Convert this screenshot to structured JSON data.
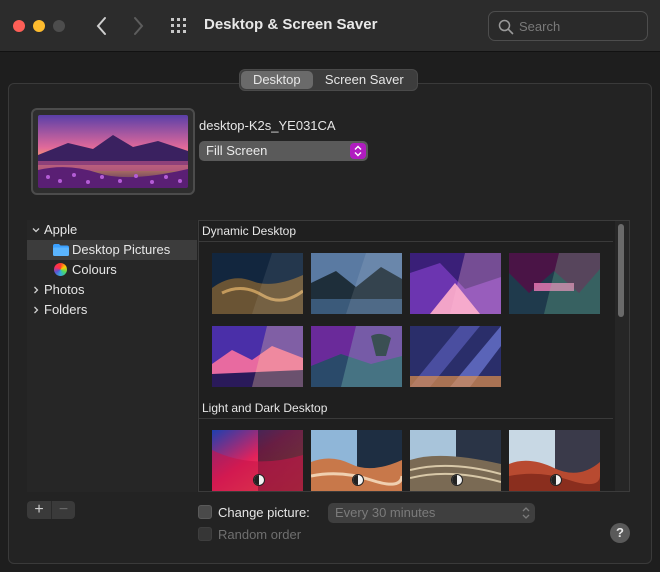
{
  "window": {
    "title": "Desktop & Screen Saver"
  },
  "search": {
    "placeholder": "Search"
  },
  "tabs": [
    {
      "label": "Desktop",
      "selected": true
    },
    {
      "label": "Screen Saver",
      "selected": false
    }
  ],
  "current": {
    "image_name": "desktop-K2s_YE031CA",
    "fit_mode": "Fill Screen"
  },
  "sidebar": {
    "items": [
      {
        "label": "Apple",
        "expanded": true
      },
      {
        "label": "Desktop Pictures",
        "selected": true,
        "icon": "folder-icon"
      },
      {
        "label": "Colours",
        "icon": "colour-wheel-icon"
      },
      {
        "label": "Photos",
        "expanded": false
      },
      {
        "label": "Folders",
        "expanded": false
      }
    ]
  },
  "sections": {
    "dynamic": {
      "title": "Dynamic Desktop"
    },
    "light_dark": {
      "title": "Light and Dark Desktop"
    }
  },
  "bottom": {
    "add_label": "+",
    "remove_label": "−",
    "change_picture_label": "Change picture:",
    "interval": "Every 30 minutes",
    "random_label": "Random order",
    "help_label": "?"
  },
  "colors": {
    "accent": "#b01cc0",
    "background": "#1e1e1e",
    "panel": "#232323"
  }
}
